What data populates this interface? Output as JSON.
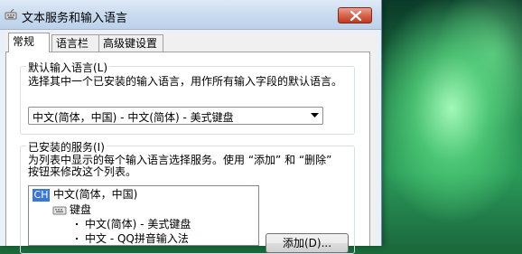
{
  "window": {
    "title": "文本服务和输入语言"
  },
  "tabs": [
    {
      "label": "常规"
    },
    {
      "label": "语言栏"
    },
    {
      "label": "高级键设置"
    }
  ],
  "default_language": {
    "group_title": "默认输入语言(L)",
    "description": "选择其中一个已安装的输入语言，用作所有输入字段的默认语言。",
    "selected_value": "中文(简体，中国) - 中文(简体) - 美式键盘"
  },
  "installed_services": {
    "group_title": "已安装的服务(I)",
    "description_line1": "为列表中显示的每个输入语言选择服务。使用 “添加” 和 “删除”",
    "description_line2": "按钮来修改这个列表。",
    "tree": {
      "language_badge": "CH",
      "language": "中文(简体，中国)",
      "category": "键盘",
      "items": [
        {
          "label": "中文(简体) - 美式键盘"
        },
        {
          "label": "中文 - QQ拼音输入法"
        }
      ]
    },
    "add_button_label": "添加(D)..."
  },
  "colors": {
    "title_bar": "#c9dbef",
    "close_button": "#c0391f",
    "selection_badge": "#3a78d4",
    "desktop": "#2a9a58"
  }
}
